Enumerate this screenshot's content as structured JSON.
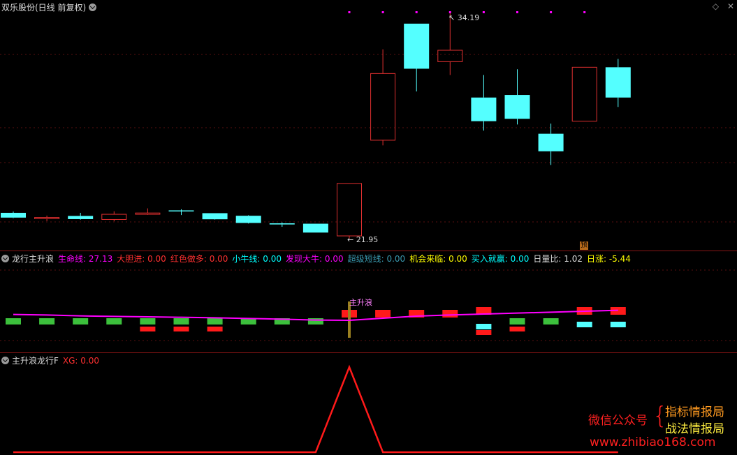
{
  "main_panel": {
    "title": "双乐股份(日线 前复权)",
    "high_label": "34.19",
    "low_label": "21.95",
    "pre_badge": "预",
    "icons": [
      "diamond-icon",
      "close-icon"
    ]
  },
  "panel2": {
    "title": "龙行主升浪",
    "indicators": [
      {
        "label": "生命线:",
        "value": "27.13",
        "color": "#ff00ff"
      },
      {
        "label": "大胆进:",
        "value": "0.00",
        "color": "#ff3030"
      },
      {
        "label": "红色做多:",
        "value": "0.00",
        "color": "#ff3030"
      },
      {
        "label": "小牛线:",
        "value": "0.00",
        "color": "#00ffff"
      },
      {
        "label": "发现大牛:",
        "value": "0.00",
        "color": "#ff00ff"
      },
      {
        "label": "超级短线:",
        "value": "0.00",
        "color": "#3a9ab0"
      },
      {
        "label": "机会来临:",
        "value": "0.00",
        "color": "#ffff00"
      },
      {
        "label": "买入就赢:",
        "value": "0.00",
        "color": "#00ffff"
      },
      {
        "label": "日量比:",
        "value": "1.02",
        "color": "#dddddd"
      },
      {
        "label": "日涨:",
        "value": "-5.44",
        "color": "#ffff00"
      }
    ],
    "signal_label": "主升浪"
  },
  "panel3": {
    "title": "主升浪龙行F",
    "indicators": [
      {
        "label": "XG:",
        "value": "0.00",
        "color": "#ff3030"
      }
    ]
  },
  "watermark": {
    "line1": "微信公众号",
    "brace": "{",
    "line2a": "指标情报局",
    "line2b": "战法情报局",
    "url": "www.zhibiao168.com"
  },
  "chart_data": {
    "type": "candlestick",
    "candles": [
      {
        "o": 23.35,
        "h": 23.42,
        "l": 23.06,
        "c": 23.09
      },
      {
        "o": 23.03,
        "h": 23.2,
        "l": 22.9,
        "c": 23.1
      },
      {
        "o": 23.18,
        "h": 23.35,
        "l": 22.98,
        "c": 23.01
      },
      {
        "o": 22.99,
        "h": 23.43,
        "l": 22.89,
        "c": 23.27
      },
      {
        "o": 23.27,
        "h": 23.59,
        "l": 23.24,
        "c": 23.34
      },
      {
        "o": 23.48,
        "h": 23.54,
        "l": 23.23,
        "c": 23.43
      },
      {
        "o": 23.33,
        "h": 23.33,
        "l": 22.98,
        "c": 23.0
      },
      {
        "o": 23.19,
        "h": 23.22,
        "l": 22.77,
        "c": 22.8
      },
      {
        "o": 22.78,
        "h": 22.83,
        "l": 22.59,
        "c": 22.72
      },
      {
        "o": 22.76,
        "h": 22.76,
        "l": 22.28,
        "c": 22.28
      },
      {
        "o": 22.1,
        "h": 24.94,
        "l": 21.95,
        "c": 24.94
      },
      {
        "o": 27.28,
        "h": 32.2,
        "l": 27.0,
        "c": 30.89
      },
      {
        "o": 33.59,
        "h": 33.59,
        "l": 29.92,
        "c": 31.15
      },
      {
        "o": 31.53,
        "h": 34.19,
        "l": 30.81,
        "c": 32.15
      },
      {
        "o": 29.59,
        "h": 30.81,
        "l": 27.8,
        "c": 28.31
      },
      {
        "o": 29.73,
        "h": 31.12,
        "l": 28.13,
        "c": 28.44
      },
      {
        "o": 27.63,
        "h": 28.18,
        "l": 25.94,
        "c": 26.68
      },
      {
        "o": 28.31,
        "h": 31.23,
        "l": 28.31,
        "c": 31.23
      },
      {
        "o": 31.23,
        "h": 31.68,
        "l": 29.08,
        "c": 29.59
      }
    ],
    "top_marks": [
      10,
      11,
      12,
      13,
      14,
      15,
      16,
      17
    ],
    "lifeline": [
      23.02,
      23.0,
      22.96,
      22.94,
      22.92,
      22.9,
      22.88,
      22.85,
      22.82,
      22.78,
      22.77,
      22.86,
      22.95,
      23.0,
      23.04,
      23.08,
      23.12,
      23.16,
      23.2
    ],
    "p2_boxes": [
      {
        "i": 0,
        "g": 1,
        "r": 0,
        "c": 0
      },
      {
        "i": 1,
        "g": 1,
        "r": 0,
        "c": 0
      },
      {
        "i": 2,
        "g": 1,
        "r": 0,
        "c": 0
      },
      {
        "i": 3,
        "g": 1,
        "r": 0,
        "c": 0
      },
      {
        "i": 4,
        "g": 1,
        "r": 1,
        "c": 0
      },
      {
        "i": 5,
        "g": 1,
        "r": 1,
        "c": 0
      },
      {
        "i": 6,
        "g": 1,
        "r": 1,
        "c": 0
      },
      {
        "i": 7,
        "g": 1,
        "r": 0,
        "c": 0
      },
      {
        "i": 8,
        "g": 1,
        "r": 0,
        "c": 0
      },
      {
        "i": 9,
        "g": 1,
        "r": 0,
        "c": 0
      },
      {
        "i": 10,
        "g": 0,
        "r": 1,
        "c": 0
      },
      {
        "i": 11,
        "g": 0,
        "r": 1,
        "c": 0
      },
      {
        "i": 12,
        "g": 0,
        "r": 1,
        "c": 0
      },
      {
        "i": 13,
        "g": 0,
        "r": 1,
        "c": 0
      },
      {
        "i": 14,
        "g": 0,
        "r": 1,
        "c": 1,
        "r2": 1
      },
      {
        "i": 15,
        "g": 1,
        "r": 1,
        "c": 0
      },
      {
        "i": 16,
        "g": 1,
        "r": 0,
        "c": 0
      },
      {
        "i": 17,
        "g": 0,
        "r": 1,
        "c": 1
      },
      {
        "i": 18,
        "g": 0,
        "r": 1,
        "c": 1
      }
    ],
    "signal_index": 10,
    "xg_series": [
      0,
      0,
      0,
      0,
      0,
      0,
      0,
      0,
      0,
      0,
      1,
      0,
      0,
      0,
      0,
      0,
      0,
      0,
      0
    ]
  }
}
